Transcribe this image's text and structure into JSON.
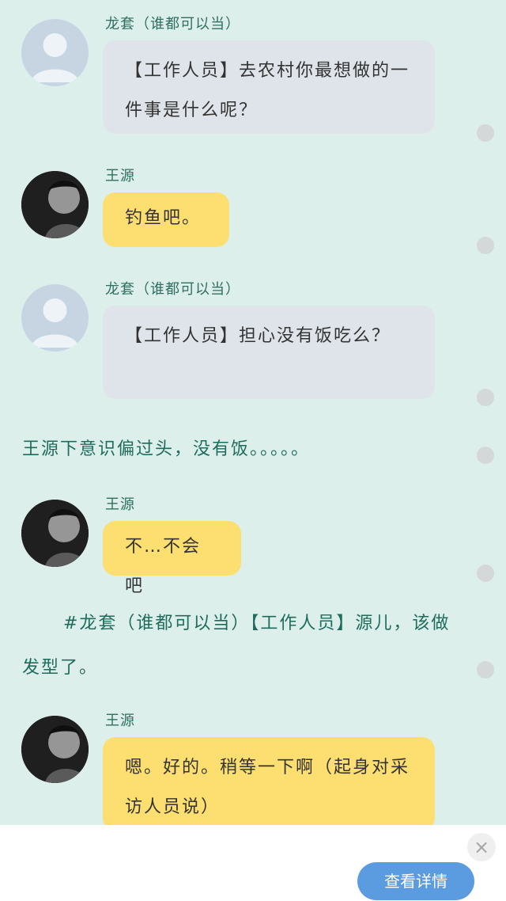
{
  "messages": [
    {
      "speaker": "龙套（谁都可以当）",
      "text": "【工作人员】去农村你最想做的一件事是什么呢？",
      "avatar": "default-user-avatar"
    },
    {
      "speaker": "王源",
      "text": "钓鱼吧。",
      "avatar": "wang-yuan-avatar"
    },
    {
      "speaker": "龙套（谁都可以当）",
      "text": "【工作人员】担心没有饭吃么？",
      "avatar": "default-user-avatar"
    },
    {
      "narration": "王源下意识偏过头，没有饭。。。。。"
    },
    {
      "speaker": "王源",
      "text": "不…不会吧",
      "avatar": "wang-yuan-avatar"
    },
    {
      "narration": "#龙套（谁都可以当）【工作人员】源儿，该做发型了。"
    },
    {
      "speaker": "王源",
      "text": "嗯。好的。稍等一下啊（起身对采访人员说）",
      "avatar": "wang-yuan-avatar"
    }
  ],
  "bottom_bar": {
    "detail_label": "查看详情",
    "close_icon": "×"
  },
  "colors": {
    "background": "#dcefeb",
    "gray_bubble": "#dfe4ea",
    "yellow_bubble": "#fcde71",
    "name_color": "#2f6f61",
    "narration_color": "#1f6c5d",
    "button_blue": "#5b9be0"
  }
}
